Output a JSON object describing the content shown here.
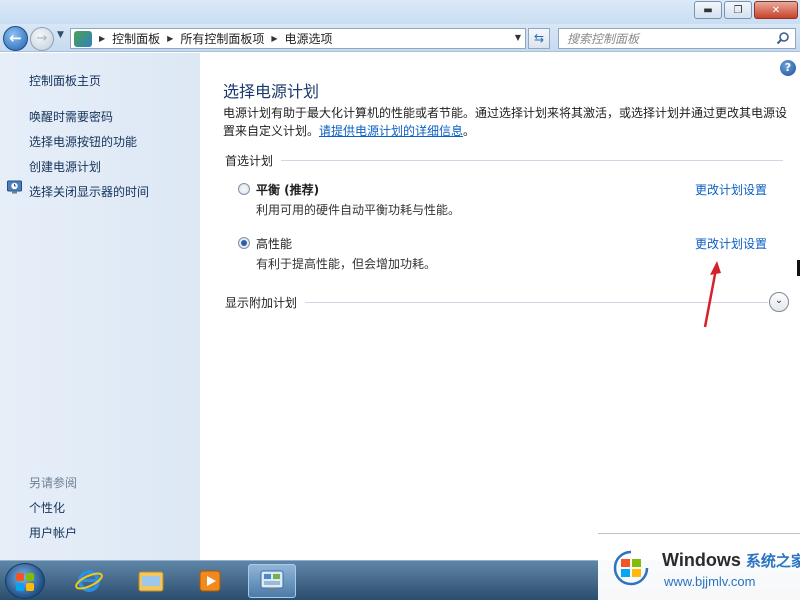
{
  "window": {
    "minimize_glyph": "▬",
    "maximize_glyph": "❐",
    "close_glyph": "✕"
  },
  "navbar": {
    "back_glyph": "←",
    "forward_glyph": "→",
    "breadcrumbs": [
      "控制面板",
      "所有控制面板项",
      "电源选项"
    ],
    "search_placeholder": "搜索控制面板"
  },
  "sidebar": {
    "home": "控制面板主页",
    "links": [
      "唤醒时需要密码",
      "选择电源按钮的功能",
      "创建电源计划",
      "选择关闭显示器的时间"
    ],
    "see_also_title": "另请参阅",
    "see_also": [
      "个性化",
      "用户帐户"
    ]
  },
  "main": {
    "title": "选择电源计划",
    "description": "电源计划有助于最大化计算机的性能或者节能。通过选择计划来将其激活，或选择计划并通过更改其电源设置来自定义计划。",
    "description_link": "请提供电源计划的详细信息",
    "description_end": "。",
    "preferred_section": "首选计划",
    "plans": [
      {
        "name": "平衡 (推荐)",
        "desc": "利用可用的硬件自动平衡功耗与性能。",
        "link": "更改计划设置",
        "selected": false
      },
      {
        "name": "高性能",
        "desc": "有利于提高性能，但会增加功耗。",
        "link": "更改计划设置",
        "selected": true
      }
    ],
    "additional_section": "显示附加计划",
    "help_glyph": "?",
    "expand_glyph": "⌄"
  },
  "watermark": {
    "title": "Windows",
    "title_cn": "系统之家",
    "url": "www.bjjmlv.com"
  },
  "colors": {
    "link": "#0b5fc2",
    "title": "#1a3a6b",
    "annotation_arrow": "#d6202a"
  }
}
